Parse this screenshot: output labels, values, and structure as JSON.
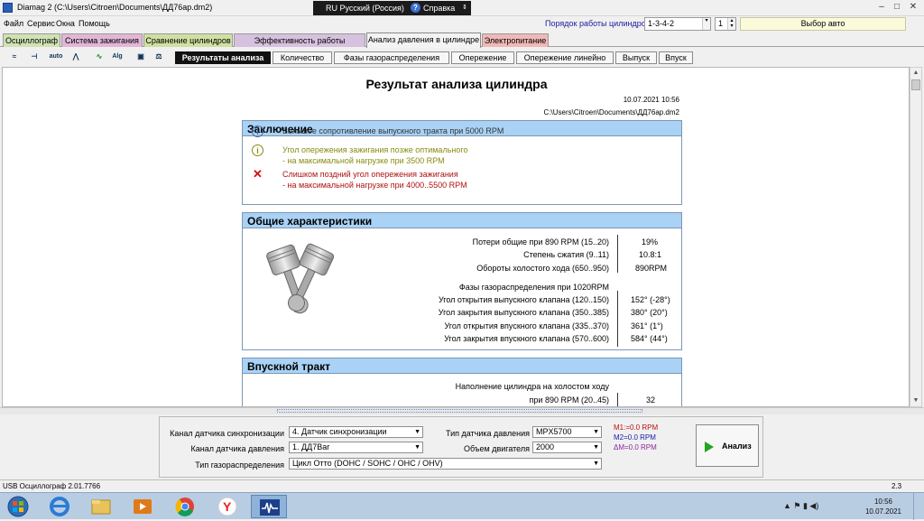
{
  "window": {
    "title": "Diamag 2 (C:\\Users\\Citroen\\Documents\\ДД76ар.dm2)",
    "min": "–",
    "max": "□",
    "close": "✕"
  },
  "lang": {
    "label": "RU Русский (Россия)",
    "help": "Справка",
    "help_q": "?"
  },
  "menu": [
    "Файл",
    "Сервис",
    "Окна",
    "Помощь"
  ],
  "cyl_order": {
    "label": "Порядок работы цилиндров",
    "value": "1-3-4-2",
    "num": "1"
  },
  "auto_button": "Выбор авто",
  "tabs": [
    "Осциллограф",
    "Система зажигания",
    "Сравнение цилиндров",
    "Эффективность работы цилиндров",
    "Анализ давления в цилиндре",
    "Электропитание"
  ],
  "colors": {
    "tab0": "#cfe3b3",
    "tab1": "#e2b6d6",
    "tab2": "#cfe0a2",
    "tab3": "#d6c1de",
    "tab4": "#f3f3f3",
    "tab5": "#f1b8b8",
    "section_head": "#a9d2f5",
    "info": "#4c6ca8",
    "warn": "#8a8a10",
    "error": "#b01010"
  },
  "toolbar_icons": [
    "signal-icon",
    "timing-icon",
    "auto-icon",
    "compare-icon",
    "wave-icon",
    "algo-icon",
    "save-icon",
    "scale-icon"
  ],
  "toolbar_glyphs": [
    "≈",
    "⊣",
    "auto",
    "⋀",
    "∿",
    "Alg",
    "▣",
    "⚖"
  ],
  "subtabs": [
    "Результаты анализа",
    "Количество",
    "Фазы газораспределения",
    "Опережение",
    "Опережение линейно",
    "Выпуск",
    "Впуск"
  ],
  "report": {
    "title": "Результат анализа цилиндра",
    "date": "10.07.2021 10:56",
    "path": "C:\\Users\\Citroen\\Documents\\ДД76ар.dm2",
    "conclusion_title": "Заключение",
    "conclusions": [
      {
        "type": "info",
        "icon": "i",
        "text1": "Большое сопротивление выпускного тракта при 5000 RPM",
        "text2": ""
      },
      {
        "type": "warn",
        "icon": "i",
        "text1": "Угол опережения зажигания позже оптимального",
        "text2": "- на максимальной нагрузке при 3500 RPM"
      },
      {
        "type": "error",
        "icon": "✕",
        "text1": "Слишком поздний угол опережения зажигания",
        "text2": "- на максимальной нагрузке при 4000..5500 RPM"
      }
    ],
    "general_title": "Общие характеристики",
    "general_rows": [
      {
        "label": "Потери общие при 890 RPM (15..20)",
        "value": "19%"
      },
      {
        "label": "Степень сжатия (9..11)",
        "value": "10.8:1"
      },
      {
        "label": "Обороты холостого хода (650..950)",
        "value": "890RPM"
      }
    ],
    "phases_label": "Фазы газораспределения при 1020RPM",
    "phase_rows": [
      {
        "label": "Угол открытия выпускного клапана (120..150)",
        "value": "152° (-28°)"
      },
      {
        "label": "Угол закрытия выпускного клапана (350..385)",
        "value": "380° (20°)"
      },
      {
        "label": "Угол открытия впускного клапана (335..370)",
        "value": "361° (1°)"
      },
      {
        "label": "Угол закрытия впускного клапана (570..600)",
        "value": "584° (44°)"
      }
    ],
    "intake_title": "Впускной тракт",
    "intake_label1": "Наполнение цилиндра на холостом ходу",
    "intake_label2": "при 890 RPM (20..45)",
    "intake_value": "32"
  },
  "bottom": {
    "sync_label": "Канал датчика синхронизации",
    "sync_value": "4. Датчик синхронизации",
    "press_label": "Канал датчика давления",
    "press_value": "1. ДД7Bar",
    "gas_label": "Тип газораспределения",
    "gas_value": "Цикл Отто (DOHC / SOHC / OHC / OHV)",
    "sensor_label": "Тип датчика давления",
    "sensor_value": "MPX5700",
    "vol_label": "Объем двигателя",
    "vol_value": "2000",
    "m1": "M1:=0.0 RPM",
    "m2": "M2=0.0 RPM",
    "dm": "ΔM=0.0 RPM",
    "analyze": "Анализ",
    "dd": "▼"
  },
  "status": {
    "left": "USB Осциллограф  2.01.7766",
    "right": "2.3"
  },
  "taskbar": {
    "time": "10:56",
    "date": "10.07.2021",
    "tray": "▲ ⚑ ▮ ◀)"
  }
}
